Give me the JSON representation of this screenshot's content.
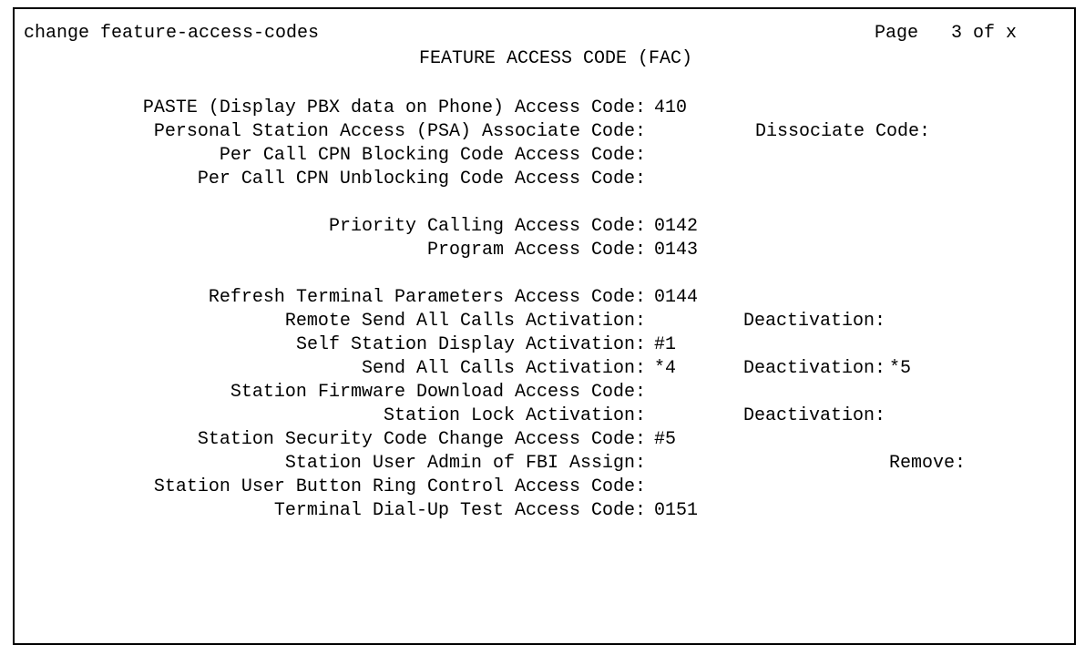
{
  "header": {
    "command": "change feature-access-codes",
    "page": "Page   3 of x",
    "title": "FEATURE ACCESS CODE (FAC)"
  },
  "rows": [
    {
      "label": "PASTE (Display PBX data on Phone) Access Code:",
      "value": "410"
    },
    {
      "label": "Personal Station Access (PSA) Associate Code:",
      "value": "",
      "label2": "Dissociate Code:",
      "value2": ""
    },
    {
      "label": "Per Call CPN Blocking Code Access Code:",
      "value": ""
    },
    {
      "label": "Per Call CPN Unblocking Code Access Code:",
      "value": ""
    },
    {
      "label": "Priority Calling Access Code:",
      "value": "0142"
    },
    {
      "label": "Program Access Code:",
      "value": "0143"
    },
    {
      "label": "Refresh Terminal Parameters Access Code:",
      "value": "0144"
    },
    {
      "label": "Remote Send All Calls Activation:",
      "value": "",
      "label2": "Deactivation:",
      "value2": ""
    },
    {
      "label": "Self Station Display Activation:",
      "value": "#1"
    },
    {
      "label": "Send All Calls Activation:",
      "value": "*4",
      "label2": "Deactivation:",
      "value2": "*5"
    },
    {
      "label": "Station Firmware Download Access Code:",
      "value": ""
    },
    {
      "label": "Station Lock Activation:",
      "value": "",
      "label2": "Deactivation:",
      "value2": ""
    },
    {
      "label": "Station Security Code Change Access Code:",
      "value": "#5"
    },
    {
      "label": "Station User Admin of FBI Assign:",
      "value": "",
      "label2": "Remove:",
      "value2": ""
    },
    {
      "label": "Station User Button Ring Control Access Code:",
      "value": ""
    },
    {
      "label": "Terminal Dial-Up Test Access Code:",
      "value": "0151"
    }
  ]
}
